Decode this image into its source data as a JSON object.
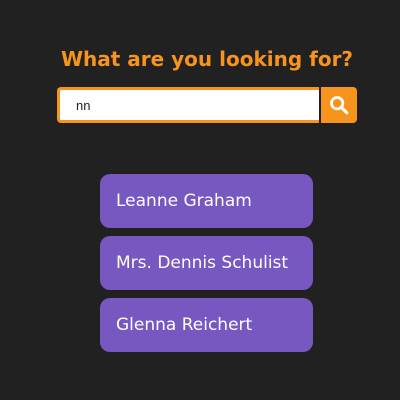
{
  "colors": {
    "background": "#212121",
    "accent": "#f7941d",
    "result_background": "#7757c0",
    "result_text": "#ffffff",
    "input_background": "#ffffff"
  },
  "heading": "What are you looking for?",
  "search": {
    "value": "nn",
    "icon": "search-icon"
  },
  "results": [
    {
      "label": "Leanne Graham"
    },
    {
      "label": "Mrs. Dennis Schulist"
    },
    {
      "label": "Glenna Reichert"
    }
  ]
}
